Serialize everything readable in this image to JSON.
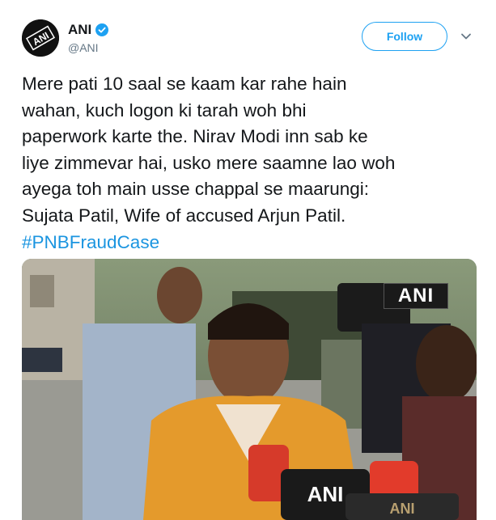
{
  "account": {
    "display_name": "ANI",
    "handle": "@ANI",
    "avatar_text": "ANI",
    "verified_icon": "verified-badge-icon"
  },
  "actions": {
    "follow_label": "Follow",
    "more_icon": "chevron-down-icon"
  },
  "tweet": {
    "text": "Mere pati 10 saal se kaam kar rahe hain\nwahan, kuch logon ki tarah woh bhi\npaperwork karte the. Nirav Modi inn sab ke\nliye zimmevar hai, usko mere saamne lao woh\nayega toh main usse chappal se maarungi:\nSujata Patil, Wife of accused Arjun Patil.",
    "hashtag": "#PNBFraudCase"
  },
  "media": {
    "watermark": "ANI",
    "mic_label": "ANI",
    "mic_label_2": "ANI"
  },
  "colors": {
    "brand_blue": "#1da1f2",
    "hashtag_blue": "#1b95e0",
    "text": "#14171a",
    "muted": "#657786"
  }
}
